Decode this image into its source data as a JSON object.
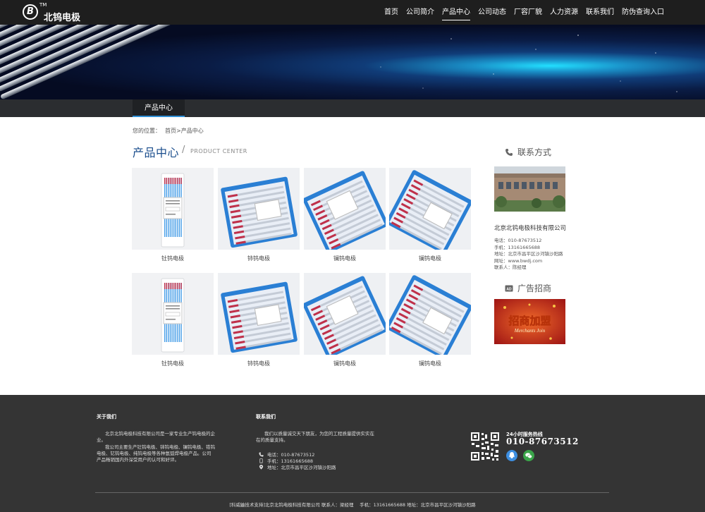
{
  "header": {
    "logo_text": "北钨电极",
    "logo_tm": "TM",
    "logo_mark": "B",
    "nav": [
      {
        "label": "首页"
      },
      {
        "label": "公司简介"
      },
      {
        "label": "产品中心"
      },
      {
        "label": "公司动态"
      },
      {
        "label": "厂容厂貌"
      },
      {
        "label": "人力资源"
      },
      {
        "label": "联系我们"
      },
      {
        "label": "防伪查询入口"
      }
    ],
    "active_nav": "产品中心"
  },
  "subnav": {
    "label": "产品中心"
  },
  "breadcrumb": {
    "prefix": "您的位置：",
    "home": "首页",
    "sep": ">",
    "current": "产品中心"
  },
  "section": {
    "title": "产品中心",
    "slash": "/",
    "subtitle": "PRODUCT CENTER"
  },
  "products": [
    {
      "name": "钍钨电极",
      "style": "pack"
    },
    {
      "name": "铈钨电极",
      "style": "box"
    },
    {
      "name": "镧钨电极",
      "style": "box2"
    },
    {
      "name": "镧钨电极",
      "style": "boxtilt"
    },
    {
      "name": "钍钨电极",
      "style": "pack"
    },
    {
      "name": "铈钨电极",
      "style": "box"
    },
    {
      "name": "镧钨电极",
      "style": "box2"
    },
    {
      "name": "镧钨电极",
      "style": "boxtilt"
    }
  ],
  "sidebar": {
    "contact_title": "联系方式",
    "company": "北京北钨电极科技有限公司",
    "info": [
      "电话：010-87673512",
      "手机：13161665688",
      "地址：北京市昌平区沙河镇沙阳路",
      "网址：www.bwdj.com",
      "联系人：陈经理"
    ],
    "ad_title": "广告招商",
    "ad_big": "招商加盟",
    "ad_small": "Merchants Join",
    "ad_icon_text": "AD"
  },
  "footer": {
    "about_title": "关于我们",
    "about_p1": "北京北钨电极科技有限公司是一家专业生产钨电极的企业。",
    "about_p2": "我公司主要生产钍钨电极、铈钨电极、镧钨电极、锆钨电极、钇钨电极、纯钨电极等各种氩弧焊电极产品。公司产品畅销国内外深受用户的认可和好评。",
    "contact_title": "联系我们",
    "contact_p": "我们以质量诚交天下朋友，为您的工程质量提供实实在在的质量支持。",
    "contact_lines": [
      {
        "icon": "phone-icon",
        "text": "电话：010-87673512"
      },
      {
        "icon": "mobile-icon",
        "text": "手机：13161665688"
      },
      {
        "icon": "location-icon",
        "text": "地址：北京市昌平区沙河镇沙阳路"
      }
    ],
    "hotline_label": "24小时服务热线",
    "hotline": "010-87673512",
    "copyright": "[科威鼬技术支持]北京北钨电极科技有限公司 联系人：梁经理　 手机：13161665688 地址：北京市昌平区沙河镇沙阳路"
  },
  "colors": {
    "topbar": "#1e1e1e",
    "accent_blue": "#1a4d8c",
    "footer_bg": "#343434",
    "electrode_tip": "#c0304a",
    "box_blue": "#2a7fd4"
  }
}
